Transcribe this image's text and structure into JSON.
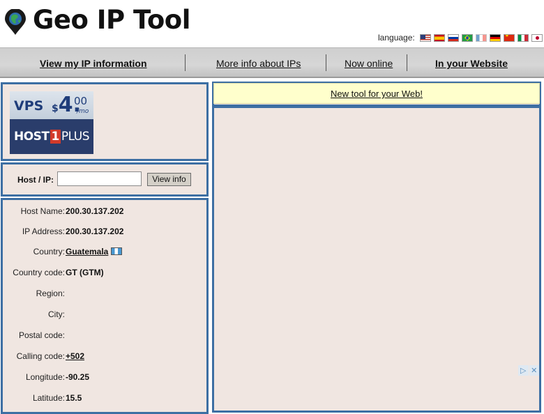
{
  "header": {
    "title": "Geo IP Tool",
    "language_label": "language:",
    "languages": [
      {
        "name": "us-flag-icon"
      },
      {
        "name": "es-flag-icon"
      },
      {
        "name": "ru-flag-icon"
      },
      {
        "name": "br-flag-icon"
      },
      {
        "name": "fr-flag-icon"
      },
      {
        "name": "de-flag-icon"
      },
      {
        "name": "cn-flag-icon"
      },
      {
        "name": "it-flag-icon"
      },
      {
        "name": "jp-flag-icon"
      }
    ]
  },
  "nav": {
    "view_my_ip": "View my IP information",
    "more_info": "More info about IPs",
    "now_online": "Now online",
    "in_your_website": "In your Website"
  },
  "ad": {
    "vps": "VPS",
    "currency": "$",
    "price_whole": "4.",
    "price_cents": "00",
    "per": "/mo",
    "brand_a": "HOST",
    "brand_one": "1",
    "brand_b": "PLUS"
  },
  "lookup": {
    "label": "Host / IP:",
    "input_value": "",
    "button": "View info"
  },
  "info": {
    "host_name_label": "Host Name:",
    "host_name": "200.30.137.202",
    "ip_label": "IP Address:",
    "ip": "200.30.137.202",
    "country_label": "Country:",
    "country": "Guatemala",
    "country_code_label": "Country code:",
    "country_code": "GT (GTM)",
    "region_label": "Region:",
    "region": "",
    "city_label": "City:",
    "city": "",
    "postal_label": "Postal code:",
    "postal": "",
    "calling_label": "Calling code:",
    "calling": "+502",
    "longitude_label": "Longitude:",
    "longitude": "-90.25",
    "latitude_label": "Latitude:",
    "latitude": "15.5"
  },
  "promo": {
    "link": "New tool for your Web!"
  },
  "adchoices": {
    "play": "▷",
    "close": "✕"
  },
  "colors": {
    "panel_border": "#3d6fa3",
    "panel_bg": "#f0e6e1",
    "promo_bg": "#ffffcc",
    "logo_pin": "#1a1a1a",
    "logo_globe": "#3aa655"
  }
}
